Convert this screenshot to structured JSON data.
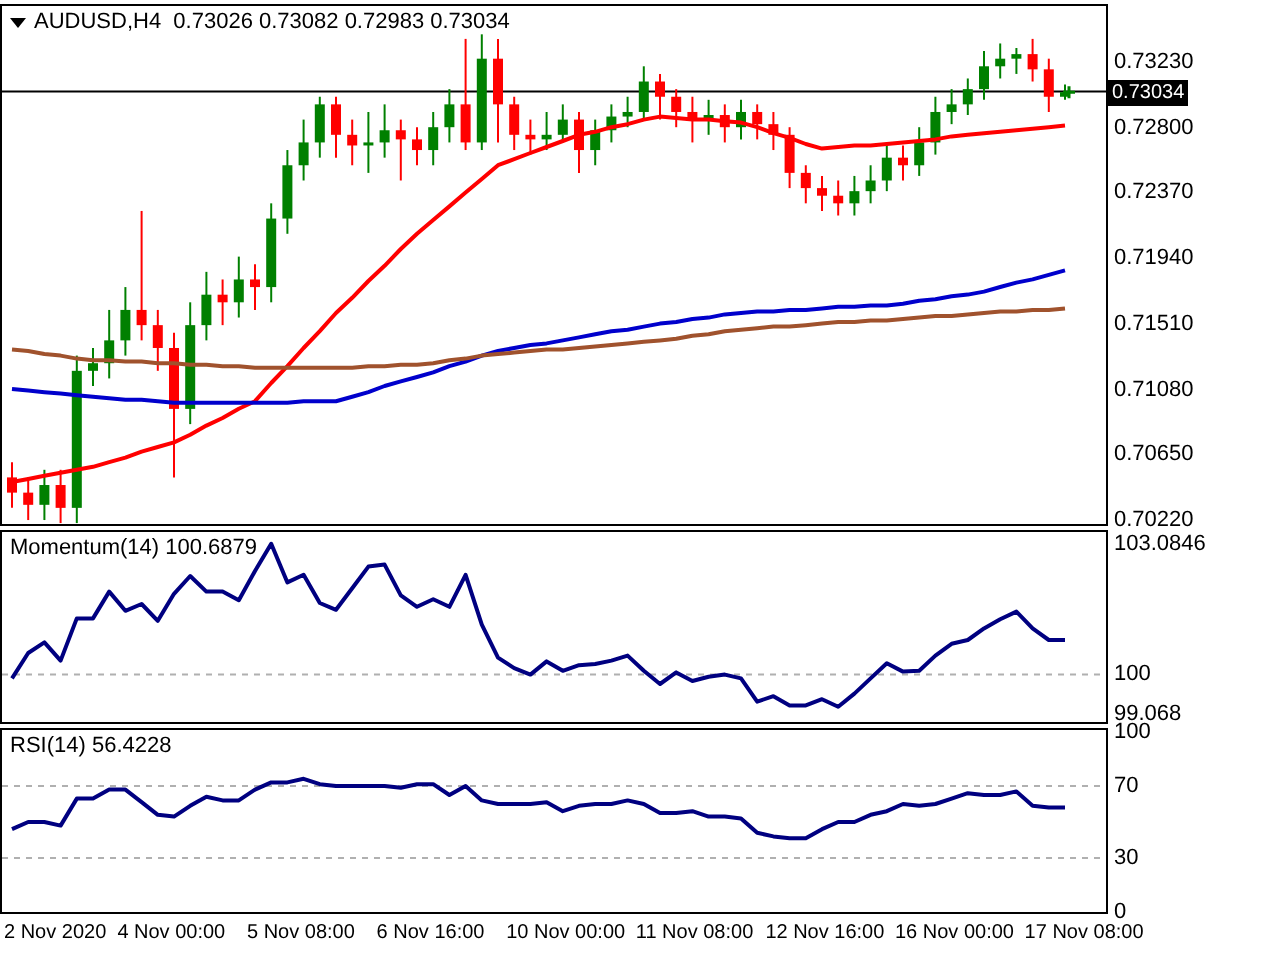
{
  "price_panel": {
    "chart_data": {
      "type": "candlestick",
      "title": "AUDUSD,H4  0.73026 0.73082 0.72983 0.73034",
      "ohlc": [
        [
          0.705,
          0.706,
          0.703,
          0.704
        ],
        [
          0.704,
          0.705,
          0.7022,
          0.7032
        ],
        [
          0.7032,
          0.7055,
          0.7022,
          0.7045
        ],
        [
          0.7045,
          0.7055,
          0.702,
          0.703
        ],
        [
          0.703,
          0.713,
          0.702,
          0.712
        ],
        [
          0.712,
          0.7135,
          0.711,
          0.7125
        ],
        [
          0.7125,
          0.716,
          0.7115,
          0.714
        ],
        [
          0.714,
          0.7175,
          0.713,
          0.716
        ],
        [
          0.716,
          0.7225,
          0.714,
          0.715
        ],
        [
          0.715,
          0.716,
          0.712,
          0.7135
        ],
        [
          0.7135,
          0.7145,
          0.705,
          0.7095
        ],
        [
          0.7095,
          0.7165,
          0.7085,
          0.715
        ],
        [
          0.715,
          0.7185,
          0.714,
          0.717
        ],
        [
          0.717,
          0.718,
          0.715,
          0.7165
        ],
        [
          0.7165,
          0.7195,
          0.7155,
          0.718
        ],
        [
          0.718,
          0.719,
          0.716,
          0.7175
        ],
        [
          0.7175,
          0.723,
          0.7165,
          0.722
        ],
        [
          0.722,
          0.7265,
          0.721,
          0.7255
        ],
        [
          0.7255,
          0.7285,
          0.7245,
          0.727
        ],
        [
          0.727,
          0.73,
          0.726,
          0.7295
        ],
        [
          0.7295,
          0.73,
          0.726,
          0.7275
        ],
        [
          0.7275,
          0.7285,
          0.7255,
          0.7268
        ],
        [
          0.7268,
          0.729,
          0.725,
          0.727
        ],
        [
          0.727,
          0.7295,
          0.726,
          0.7278
        ],
        [
          0.7278,
          0.7285,
          0.7245,
          0.7272
        ],
        [
          0.7272,
          0.728,
          0.7255,
          0.7265
        ],
        [
          0.7265,
          0.729,
          0.7255,
          0.728
        ],
        [
          0.728,
          0.7305,
          0.727,
          0.7295
        ],
        [
          0.7295,
          0.7338,
          0.7265,
          0.727
        ],
        [
          0.727,
          0.7341,
          0.7265,
          0.7325
        ],
        [
          0.7325,
          0.7338,
          0.727,
          0.7295
        ],
        [
          0.7295,
          0.73,
          0.7265,
          0.7275
        ],
        [
          0.7275,
          0.7285,
          0.7262,
          0.7272
        ],
        [
          0.7272,
          0.729,
          0.7265,
          0.7275
        ],
        [
          0.7275,
          0.7295,
          0.727,
          0.7285
        ],
        [
          0.7285,
          0.729,
          0.725,
          0.7265
        ],
        [
          0.7265,
          0.7285,
          0.7255,
          0.7278
        ],
        [
          0.7278,
          0.7295,
          0.727,
          0.7287
        ],
        [
          0.7287,
          0.73,
          0.728,
          0.729
        ],
        [
          0.729,
          0.732,
          0.7285,
          0.731
        ],
        [
          0.731,
          0.7315,
          0.7285,
          0.73
        ],
        [
          0.73,
          0.7305,
          0.728,
          0.729
        ],
        [
          0.729,
          0.73,
          0.727,
          0.7285
        ],
        [
          0.7285,
          0.7298,
          0.7275,
          0.7288
        ],
        [
          0.7288,
          0.7295,
          0.727,
          0.728
        ],
        [
          0.728,
          0.7298,
          0.7272,
          0.729
        ],
        [
          0.729,
          0.7295,
          0.7272,
          0.7282
        ],
        [
          0.7282,
          0.729,
          0.7265,
          0.7275
        ],
        [
          0.7275,
          0.728,
          0.724,
          0.725
        ],
        [
          0.725,
          0.7255,
          0.723,
          0.724
        ],
        [
          0.724,
          0.7248,
          0.7225,
          0.7235
        ],
        [
          0.7235,
          0.7245,
          0.7222,
          0.723
        ],
        [
          0.723,
          0.7248,
          0.7222,
          0.7238
        ],
        [
          0.7238,
          0.7255,
          0.723,
          0.7245
        ],
        [
          0.7245,
          0.727,
          0.7238,
          0.726
        ],
        [
          0.726,
          0.7268,
          0.7245,
          0.7255
        ],
        [
          0.7255,
          0.728,
          0.7248,
          0.727
        ],
        [
          0.727,
          0.73,
          0.7262,
          0.729
        ],
        [
          0.729,
          0.7305,
          0.7282,
          0.7295
        ],
        [
          0.7295,
          0.7312,
          0.7288,
          0.7305
        ],
        [
          0.7305,
          0.733,
          0.7298,
          0.732
        ],
        [
          0.732,
          0.7335,
          0.7312,
          0.7325
        ],
        [
          0.7325,
          0.7332,
          0.7315,
          0.7328
        ],
        [
          0.7328,
          0.7338,
          0.731,
          0.7318
        ],
        [
          0.7318,
          0.7325,
          0.729,
          0.73
        ],
        [
          0.73,
          0.7308,
          0.7298,
          0.7303
        ]
      ],
      "ylim": [
        0.70194,
        0.73596
      ],
      "yticks": [
        {
          "value": 0.7323,
          "label": "0.73230"
        },
        {
          "value": 0.728,
          "label": "0.72800"
        },
        {
          "value": 0.7237,
          "label": "0.72370"
        },
        {
          "value": 0.7194,
          "label": "0.71940"
        },
        {
          "value": 0.7151,
          "label": "0.71510"
        },
        {
          "value": 0.7108,
          "label": "0.71080"
        },
        {
          "value": 0.7065,
          "label": "0.70650"
        },
        {
          "value": 0.7022,
          "label": "0.70220"
        }
      ],
      "ref_lines": [
        {
          "axis": "y",
          "value": 0.73034,
          "label": "0.73034"
        }
      ]
    },
    "moving_averages": {
      "chart_data": {
        "type": "line",
        "ylim": [
          0.70194,
          0.73596
        ],
        "series": [
          {
            "color": "#ff0000",
            "values": [
              0.7047,
              0.7049,
              0.7051,
              0.7053,
              0.7055,
              0.7057,
              0.706,
              0.7063,
              0.7067,
              0.707,
              0.7073,
              0.7078,
              0.7084,
              0.7089,
              0.7095,
              0.71,
              0.7112,
              0.7123,
              0.7135,
              0.7146,
              0.7158,
              0.7168,
              0.7179,
              0.7189,
              0.72,
              0.721,
              0.7219,
              0.7228,
              0.7237,
              0.7246,
              0.7255,
              0.7259,
              0.7263,
              0.7267,
              0.7271,
              0.7275,
              0.7277,
              0.728,
              0.7282,
              0.7285,
              0.7287,
              0.7286,
              0.7285,
              0.7285,
              0.7284,
              0.7283,
              0.728,
              0.7276,
              0.7273,
              0.7269,
              0.7266,
              0.7267,
              0.7268,
              0.7268,
              0.7269,
              0.727,
              0.7271,
              0.7272,
              0.7274,
              0.7275,
              0.7276,
              0.7277,
              0.7278,
              0.7279,
              0.728,
              0.7281
            ]
          },
          {
            "color": "#0000cc",
            "values": [
              0.7108,
              0.7107,
              0.7106,
              0.7105,
              0.7104,
              0.7103,
              0.7102,
              0.7101,
              0.7101,
              0.71,
              0.7099,
              0.7099,
              0.7099,
              0.7099,
              0.7099,
              0.7099,
              0.7099,
              0.7099,
              0.71,
              0.71,
              0.71,
              0.7103,
              0.7106,
              0.711,
              0.7113,
              0.7116,
              0.7119,
              0.7123,
              0.7126,
              0.713,
              0.7133,
              0.7135,
              0.7137,
              0.7138,
              0.714,
              0.7142,
              0.7144,
              0.7146,
              0.7147,
              0.7149,
              0.7151,
              0.7152,
              0.7154,
              0.7155,
              0.7157,
              0.7158,
              0.7159,
              0.7159,
              0.716,
              0.716,
              0.7161,
              0.7162,
              0.7162,
              0.7163,
              0.7163,
              0.7164,
              0.7166,
              0.7167,
              0.7169,
              0.717,
              0.7172,
              0.7175,
              0.7178,
              0.718,
              0.7183,
              0.7186
            ]
          },
          {
            "color": "#a0522d",
            "values": [
              0.7134,
              0.7133,
              0.7131,
              0.713,
              0.7128,
              0.7127,
              0.7127,
              0.7126,
              0.7126,
              0.7125,
              0.7125,
              0.7124,
              0.7124,
              0.7123,
              0.7123,
              0.7122,
              0.7122,
              0.7122,
              0.7122,
              0.7122,
              0.7122,
              0.7122,
              0.7123,
              0.7123,
              0.7124,
              0.7124,
              0.7125,
              0.7127,
              0.7128,
              0.713,
              0.7131,
              0.7132,
              0.7133,
              0.7134,
              0.7134,
              0.7135,
              0.7136,
              0.7137,
              0.7138,
              0.7139,
              0.714,
              0.7141,
              0.7143,
              0.7144,
              0.7146,
              0.7147,
              0.7148,
              0.7149,
              0.7149,
              0.715,
              0.7151,
              0.7152,
              0.7152,
              0.7153,
              0.7153,
              0.7154,
              0.7155,
              0.7156,
              0.7156,
              0.7157,
              0.7158,
              0.7159,
              0.7159,
              0.716,
              0.716,
              0.7161
            ]
          }
        ]
      }
    }
  },
  "momentum_panel": {
    "chart_data": {
      "type": "line",
      "title": "Momentum(14) 100.6879",
      "ylim": [
        98.88,
        103.37
      ],
      "series": [
        {
          "color": "#000080",
          "values": [
            99.91,
            100.51,
            100.76,
            100.33,
            101.33,
            101.33,
            101.96,
            101.51,
            101.67,
            101.27,
            101.91,
            102.33,
            101.96,
            101.96,
            101.76,
            102.45,
            103.09,
            102.18,
            102.36,
            101.69,
            101.53,
            102.04,
            102.55,
            102.6,
            101.87,
            101.6,
            101.78,
            101.6,
            102.36,
            101.18,
            100.4,
            100.15,
            100.0,
            100.31,
            100.09,
            100.22,
            100.25,
            100.33,
            100.45,
            100.09,
            99.78,
            100.05,
            99.85,
            99.95,
            100.0,
            99.91,
            99.36,
            99.49,
            99.27,
            99.27,
            99.42,
            99.24,
            99.55,
            99.91,
            100.27,
            100.07,
            100.09,
            100.45,
            100.73,
            100.82,
            101.09,
            101.31,
            101.49,
            101.09,
            100.82,
            100.82
          ]
        }
      ],
      "yticks": [
        {
          "value": 103.0846,
          "label": "103.0846"
        },
        {
          "value": 100,
          "label": "100"
        },
        {
          "value": 99.068,
          "label": "99.068"
        }
      ],
      "ref_lines": [
        {
          "axis": "y",
          "value": 100
        }
      ]
    }
  },
  "rsi_panel": {
    "chart_data": {
      "type": "line",
      "title": "RSI(14) 56.4228",
      "ylim": [
        0,
        101.1
      ],
      "series": [
        {
          "color": "#000080",
          "values": [
            46,
            50,
            50,
            48,
            63,
            63,
            68,
            68,
            61,
            54,
            53,
            59,
            64,
            62,
            62,
            68,
            72,
            72,
            74,
            71,
            70,
            70,
            70,
            70,
            69,
            71,
            71,
            65,
            70,
            62,
            60,
            60,
            60,
            61,
            56,
            59,
            60,
            60,
            62,
            60,
            55,
            55,
            56,
            53,
            53,
            52,
            44,
            42,
            41,
            41,
            46,
            50,
            50,
            54,
            56,
            60,
            59,
            60,
            63,
            66,
            65,
            65,
            67,
            59,
            58,
            58
          ]
        }
      ],
      "yticks": [
        {
          "value": 100,
          "label": "100"
        },
        {
          "value": 70,
          "label": "70"
        },
        {
          "value": 30,
          "label": "30"
        },
        {
          "value": 0,
          "label": "0"
        }
      ],
      "ref_lines": [
        {
          "axis": "y",
          "value": 70
        },
        {
          "axis": "y",
          "value": 30
        }
      ]
    }
  },
  "time_axis": [
    "2 Nov 2020",
    "4 Nov 00:00",
    "5 Nov 08:00",
    "6 Nov 16:00",
    "10 Nov 00:00",
    "11 Nov 08:00",
    "12 Nov 16:00",
    "16 Nov 00:00",
    "17 Nov 08:00"
  ]
}
